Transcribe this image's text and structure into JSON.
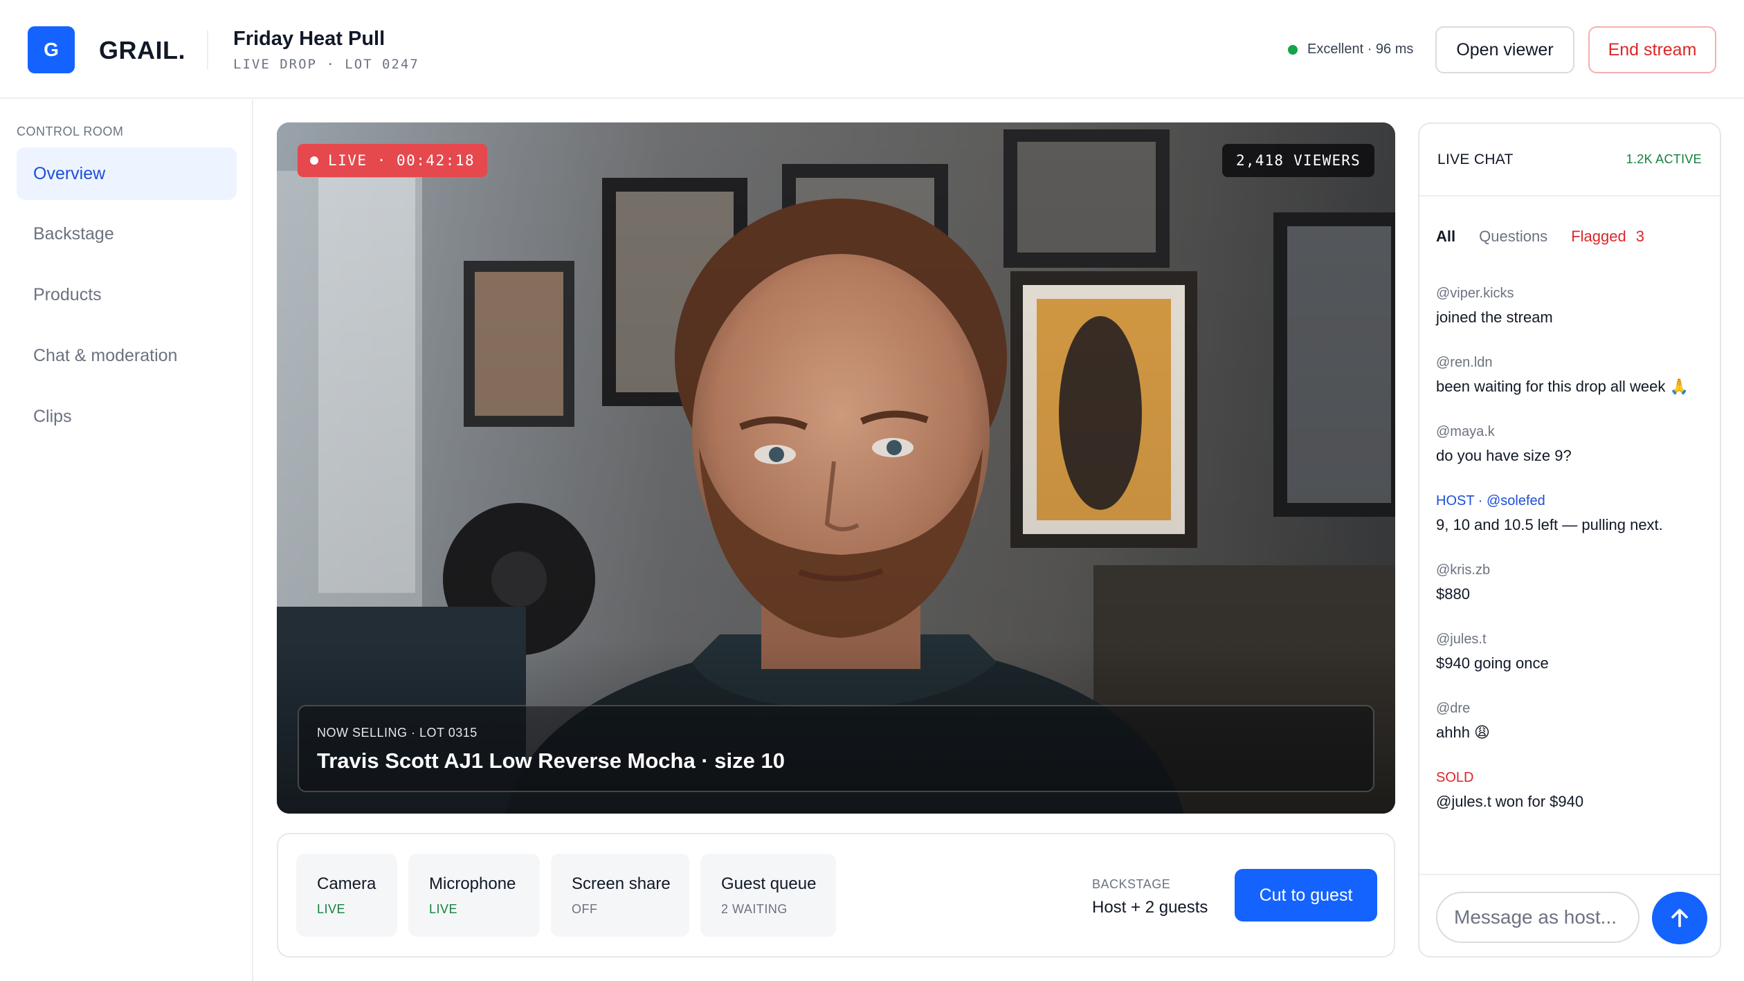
{
  "header": {
    "logo_letter": "G",
    "brand": "GRAIL.",
    "title": "Friday Heat Pull",
    "subtitle": "LIVE DROP · LOT 0247",
    "connection": "Excellent · 96 ms",
    "open_viewer_label": "Open viewer",
    "end_stream_label": "End stream"
  },
  "sidebar": {
    "heading": "CONTROL ROOM",
    "items": [
      {
        "label": "Overview",
        "active": true
      },
      {
        "label": "Backstage"
      },
      {
        "label": "Products"
      },
      {
        "label": "Chat & moderation"
      },
      {
        "label": "Clips"
      }
    ]
  },
  "video": {
    "live_label": "LIVE · 00:42:18",
    "viewers_label": "2,418 VIEWERS",
    "now_selling_label": "NOW SELLING · LOT 0315",
    "now_selling_item": "Travis Scott AJ1 Low Reverse Mocha · size 10"
  },
  "controls": {
    "items": [
      {
        "name": "Camera",
        "state": "LIVE"
      },
      {
        "name": "Microphone",
        "state": "LIVE"
      },
      {
        "name": "Screen share",
        "state": "OFF"
      },
      {
        "name": "Guest queue",
        "state": "2 WAITING"
      }
    ],
    "backstage_label": "BACKSTAGE",
    "backstage_value": "Host + 2 guests",
    "cut_label": "Cut to guest"
  },
  "chat": {
    "title": "LIVE CHAT",
    "active": "1.2K ACTIVE",
    "tabs": {
      "all": "All",
      "questions": "Questions",
      "flagged": "Flagged",
      "flagged_count": "3"
    },
    "messages": [
      {
        "user": "@viper.kicks",
        "text": "joined the stream"
      },
      {
        "user": "@ren.ldn",
        "text": "been waiting for this drop all week 🙏"
      },
      {
        "user": "@maya.k",
        "text": "do you have size 9?"
      },
      {
        "user": "HOST · @solefed",
        "text": "9, 10 and 10.5 left — pulling next."
      },
      {
        "user": "@kris.zb",
        "text": "$880"
      },
      {
        "user": "@jules.t",
        "text": "$940 going once"
      },
      {
        "user": "@dre",
        "text": "ahhh 😩"
      },
      {
        "user": "SOLD",
        "text": "@jules.t won for $940"
      }
    ],
    "input_placeholder": "Message as host...",
    "send_icon": "arrow-up-icon"
  },
  "colors": {
    "accent": "#1463ff",
    "live_red": "#e5484d",
    "success": "#15803d",
    "danger": "#dc2626"
  }
}
